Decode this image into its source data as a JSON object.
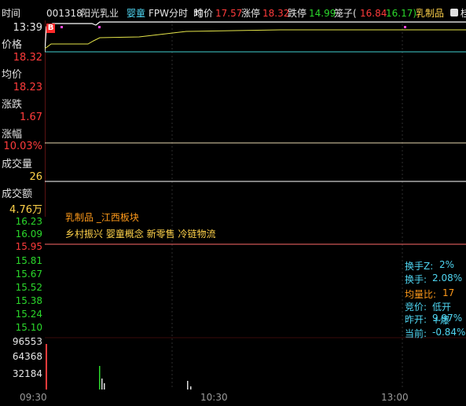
{
  "header": {
    "time_label": "时间",
    "code": "001318",
    "name": "阳光乳业",
    "tag": "婴童",
    "mode": "FPW分时",
    "time_tab": "时",
    "avg_label": "均价",
    "avg_value": "17.57",
    "limit_up_label": "涨停",
    "limit_up_value": "18.32",
    "limit_down_label": "跌停",
    "limit_down_value": "14.99",
    "cage_label": "笼子(",
    "cage_low": "16.84",
    "cage_high": "16.17)",
    "sector": "乳制品",
    "tail": "桂"
  },
  "sidebar": {
    "time_value": "13:39",
    "price_label": "价格",
    "price_value": "18.32",
    "avg_label": "均价",
    "avg_value": "18.23",
    "change_label": "涨跌",
    "change_value": "1.67",
    "pct_label": "涨幅",
    "pct_value": "10.03%",
    "volume_label": "成交量",
    "volume_value": "26",
    "amount_label": "成交额",
    "amount_value": "4.76万"
  },
  "price_axis": {
    "labels": [
      "16.23",
      "16.09",
      "15.95",
      "15.81",
      "15.67",
      "15.52",
      "15.38",
      "15.24",
      "15.10"
    ],
    "colors": [
      "#2bd82b",
      "#2bd82b",
      "#ff3b3b",
      "#2bd82b",
      "#2bd82b",
      "#2bd82b",
      "#2bd82b",
      "#2bd82b",
      "#2bd82b"
    ]
  },
  "volume_axis": {
    "labels": [
      "96553",
      "64368",
      "32184"
    ]
  },
  "time_axis": {
    "labels": [
      "09:30",
      "10:30",
      "13:00"
    ]
  },
  "concepts": {
    "line1": "乳制品 _江西板块",
    "line2": "乡村振兴 婴童概念 新零售 冷链物流"
  },
  "stats": {
    "turnover_z_label": "换手Z:",
    "turnover_z_value": "2%",
    "turnover_label": "换手:",
    "turnover_value": "2.08%",
    "vol_ratio_label": "均量比:",
    "vol_ratio_value": "17",
    "auction_label": "竞价:",
    "auction_value": "低开+爆",
    "prev_open_label": "昨开:",
    "prev_open_value": "9.97%",
    "current_label": "当前:",
    "current_value": "-0.84%"
  },
  "markers": {
    "buy_badge": "B"
  },
  "colors": {
    "price_line": "#ffffff",
    "avg_line": "#e6e64a",
    "limit_line": "#3fd0d0",
    "up": "#ff3b3b",
    "down": "#2bd82b"
  }
}
